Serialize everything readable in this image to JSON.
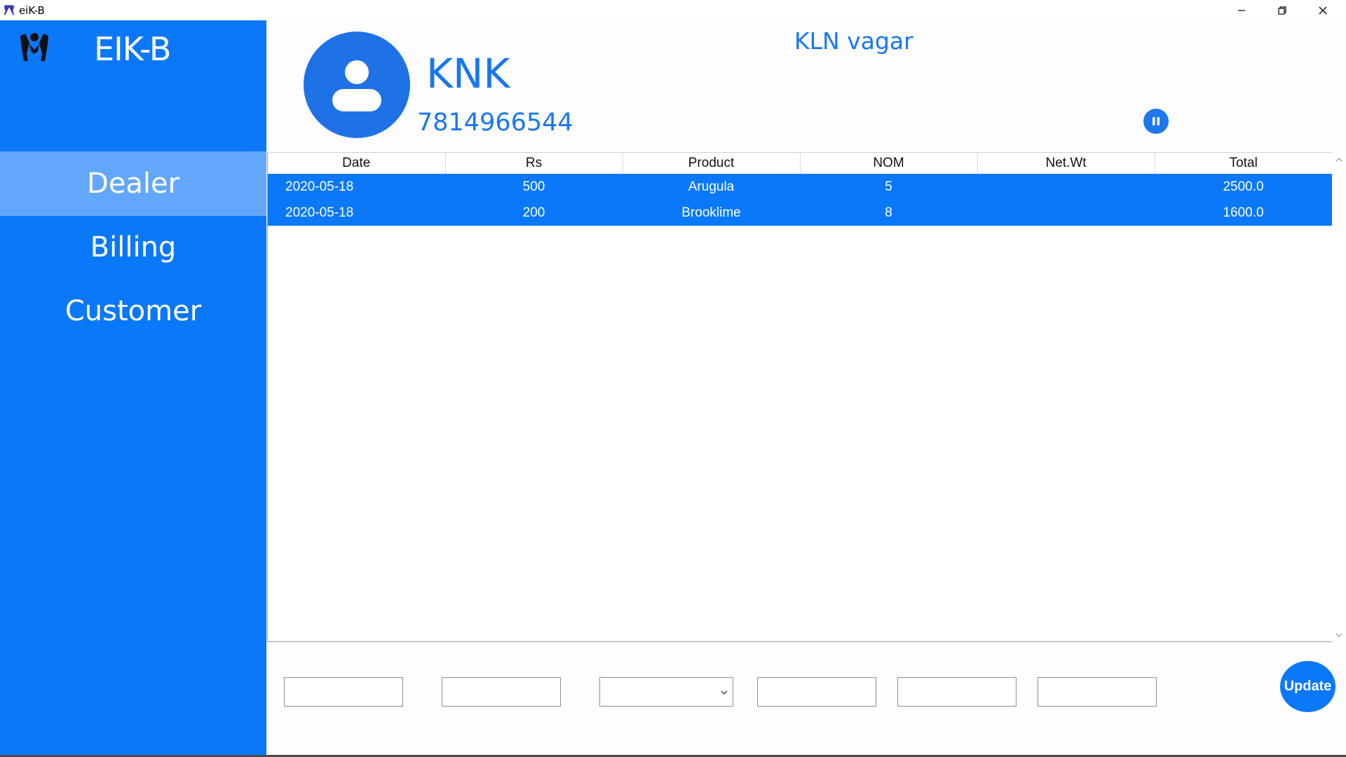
{
  "window": {
    "title": "eiK-B",
    "controls": [
      "minimize-icon",
      "restore-icon",
      "close-icon"
    ]
  },
  "sidebar": {
    "brand": "EIK-B",
    "brand_icon": "hands-logo-icon",
    "items": [
      {
        "label": "Dealer",
        "active": true
      },
      {
        "label": "Billing",
        "active": false
      },
      {
        "label": "Customer",
        "active": false
      }
    ]
  },
  "header": {
    "avatar_icon": "user-avatar-icon",
    "name": "KNK",
    "phone": "7814966544",
    "location": "KLN vagar",
    "pause_icon": "pause-icon"
  },
  "table": {
    "columns": [
      "Date",
      "Rs",
      "Product",
      "NOM",
      "Net.Wt",
      "Total"
    ],
    "rows": [
      [
        "2020-05-18",
        "500",
        "Arugula",
        "5",
        "",
        "2500.0"
      ],
      [
        "2020-05-18",
        "200",
        "Brooklime",
        "8",
        "",
        "1600.0"
      ]
    ]
  },
  "form": {
    "fields": [
      "",
      "",
      "",
      "",
      ""
    ],
    "select_value": "",
    "update_label": "Update"
  },
  "colors": {
    "primary": "#0b78fa",
    "active_nav": "#62a7fc",
    "text_accent": "#1877f2"
  }
}
